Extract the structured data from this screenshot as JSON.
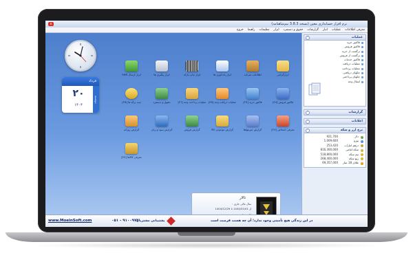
{
  "window": {
    "title": "نرم افزار حسابداری معین (نسخه 3.8.3 نیم‌شاهنامه)",
    "close_label": "x"
  },
  "menu": [
    "معرفی اطلاعات",
    "عملیات",
    "انبار",
    "گزارشات",
    "حقوق و دستمزد",
    "ابزار",
    "تنظیمات",
    "راهنما",
    "خروج"
  ],
  "calendar": {
    "month": "فرداد",
    "weekday": "دوشنبه",
    "day": "۲۰",
    "year": "۱۴۰۴"
  },
  "icons": [
    {
      "label": "ابزارگرامی",
      "color": "#e6b64a"
    },
    {
      "label": "اطلاعات شرکت",
      "color": "#c38b3a"
    },
    {
      "label": "ابزار یادداوری ها",
      "color": "#5a8de0"
    },
    {
      "label": "ابزار چاپ بارکد",
      "color": "#f2f2f2"
    },
    {
      "label": "ابزار پیگیری ها",
      "color": "#d9dde8"
    },
    {
      "label": "ابزار ارسال SMS",
      "color": "#5fb54a"
    },
    {
      "label": "فاکتور فروش [F4]",
      "color": "#4f7fd1"
    },
    {
      "label": "فاکتور خرید [F5]",
      "color": "#5a9ddc"
    },
    {
      "label": "عملیات دریافت وجه [F6]",
      "color": "#ef9f3c"
    },
    {
      "label": "عملیات پرداخت وجه [F7]",
      "color": "#e4b44f"
    },
    {
      "label": "حقوق و دستمزد",
      "color": "#4c9f54"
    },
    {
      "label": "ثبت برگه ها [F8]",
      "color": "#e9c23a"
    },
    {
      "label": "معرفی اشخاص [F3]",
      "color": "#d95a44"
    },
    {
      "label": "گزارش چیزمهاها",
      "color": "#6b8bd1"
    },
    {
      "label": "گزارش موجودی کالا",
      "color": "#e7c04a"
    },
    {
      "label": "گزارش فروش",
      "color": "#4a9a50"
    },
    {
      "label": "گزارش سود و زیان",
      "color": "#3f7fc9"
    },
    {
      "label": "گزارش روزانه",
      "color": "#e8a93e"
    },
    {
      "label": "معرفی کالاها [F2]",
      "color": "#e0b040"
    }
  ],
  "profile": {
    "name": "تالار",
    "fiscal_year_label": "سال مالی جاری :",
    "date_from": "1404/01/01",
    "from_label": "از",
    "date_to": "1404/12/29",
    "to_label": "تا",
    "user_label": "کاربر جاری :",
    "user_value": "مدیریت"
  },
  "sidebar": {
    "operations_title": "عملیات",
    "operations": [
      "فاکتور خرید",
      "فاکتور فروش",
      "برگشت از خرید",
      "برگشت از فروش",
      "فاکتور خدمات",
      "عملیات دریافت",
      "عملیات پرداخت",
      "چکهای دریافتی",
      "چکهای پرداختی",
      "انتقال وجه"
    ],
    "reports_title": "گزارشات",
    "notes_title": "اعلانات",
    "prices_title": "نرخ ارز و سکه",
    "prices": [
      {
        "name": "دلار",
        "value": "921,700"
      },
      {
        "name": "یورو",
        "value": "1,009,600"
      },
      {
        "name": "درهم امارات",
        "value": "253,420"
      },
      {
        "name": "سکه امامی",
        "value": "816,300,000"
      },
      {
        "name": "نیم سکه",
        "value": "518,800,000"
      },
      {
        "name": "ربع سکه",
        "value": "268,400,000"
      },
      {
        "name": "طلای 18 عیار",
        "value": "69,357,000"
      }
    ]
  },
  "status": {
    "website": "www.MoeinSoft.com",
    "phone": "۰۵۱ - ۹۱۰۰۹۷۲",
    "support_label": "پشتیبانی مشتریان",
    "motto": "در این زندگی هیچ تأمینی وجود ندارد؛ آن چه هست فرصت است"
  }
}
